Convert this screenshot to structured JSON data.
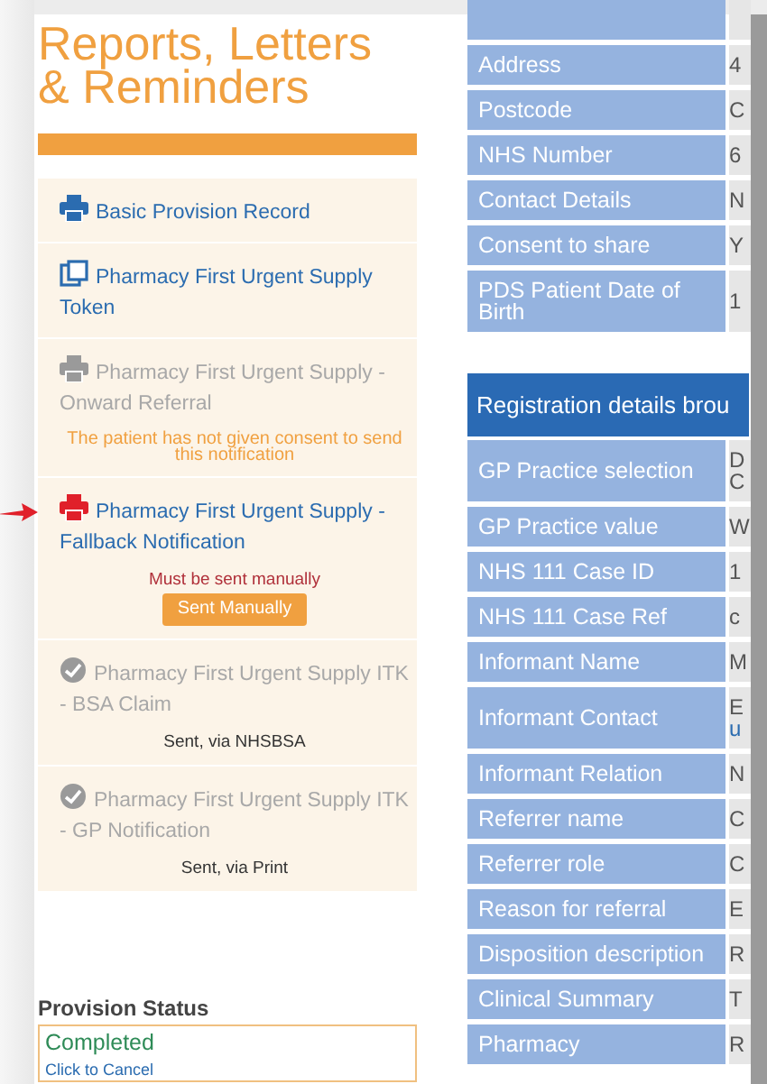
{
  "title": "Reports, Letters & Reminders",
  "reports": [
    {
      "label": "Basic Provision Record",
      "kind": "printer",
      "color": "#2b6cb0",
      "disabled": false,
      "marked": false
    },
    {
      "label": "Pharmacy First Urgent Supply Token",
      "kind": "token",
      "color": "#2b6cb0",
      "disabled": false,
      "marked": false
    },
    {
      "label": "Pharmacy First Urgent Supply - Onward Referral",
      "kind": "printer",
      "color": "#9a9a9a",
      "disabled": true,
      "marked": false,
      "note": {
        "kind": "warning",
        "text": "The patient has not given consent to send this notification"
      }
    },
    {
      "label": "Pharmacy First Urgent Supply - Fallback Notification",
      "kind": "printer",
      "color": "#e0202a",
      "disabled": false,
      "marked": true,
      "note": {
        "kind": "error",
        "text": "Must be sent manually"
      },
      "button": "Sent Manually"
    },
    {
      "label": "Pharmacy First Urgent Supply ITK - BSA Claim",
      "kind": "sent",
      "color": "#9a9a9a",
      "disabled": true,
      "marked": false,
      "note": {
        "kind": "info",
        "text": "Sent, via NHSBSA"
      }
    },
    {
      "label": "Pharmacy First Urgent Supply ITK - GP Notification",
      "kind": "sent",
      "color": "#9a9a9a",
      "disabled": true,
      "marked": false,
      "note": {
        "kind": "info",
        "text": "Sent, via Print"
      }
    }
  ],
  "provision_status": {
    "heading": "Provision Status",
    "status": "Completed",
    "link": "Click to Cancel"
  },
  "patient_table": {
    "rows": [
      {
        "label": "",
        "value": ""
      },
      {
        "label": "Address",
        "value": "4"
      },
      {
        "label": "Postcode",
        "value": "C"
      },
      {
        "label": "NHS Number",
        "value": "6"
      },
      {
        "label": "Contact Details",
        "value": "N"
      },
      {
        "label": "Consent to share",
        "value": "Y"
      },
      {
        "label": "PDS Patient Date of Birth",
        "value": "1"
      }
    ]
  },
  "registration_table": {
    "heading": "Registration details brou",
    "rows": [
      {
        "label": "GP Practice selection",
        "value": "D",
        "value_2": "C"
      },
      {
        "label": "GP Practice value",
        "value": "W"
      },
      {
        "label": "NHS 111 Case ID",
        "value": "1"
      },
      {
        "label": "NHS 111 Case Ref",
        "value": "c"
      },
      {
        "label": "Informant Name",
        "value": "M"
      },
      {
        "label": "Informant Contact",
        "value": "E",
        "link": "u"
      },
      {
        "label": "Informant Relation",
        "value": "N"
      },
      {
        "label": "Referrer name",
        "value": "C"
      },
      {
        "label": "Referrer role",
        "value": "C"
      },
      {
        "label": "Reason for referral",
        "value": "E"
      },
      {
        "label": "Disposition description",
        "value": "R"
      },
      {
        "label": "Clinical Summary",
        "value": "T"
      },
      {
        "label": "Pharmacy",
        "value": "R"
      }
    ]
  }
}
